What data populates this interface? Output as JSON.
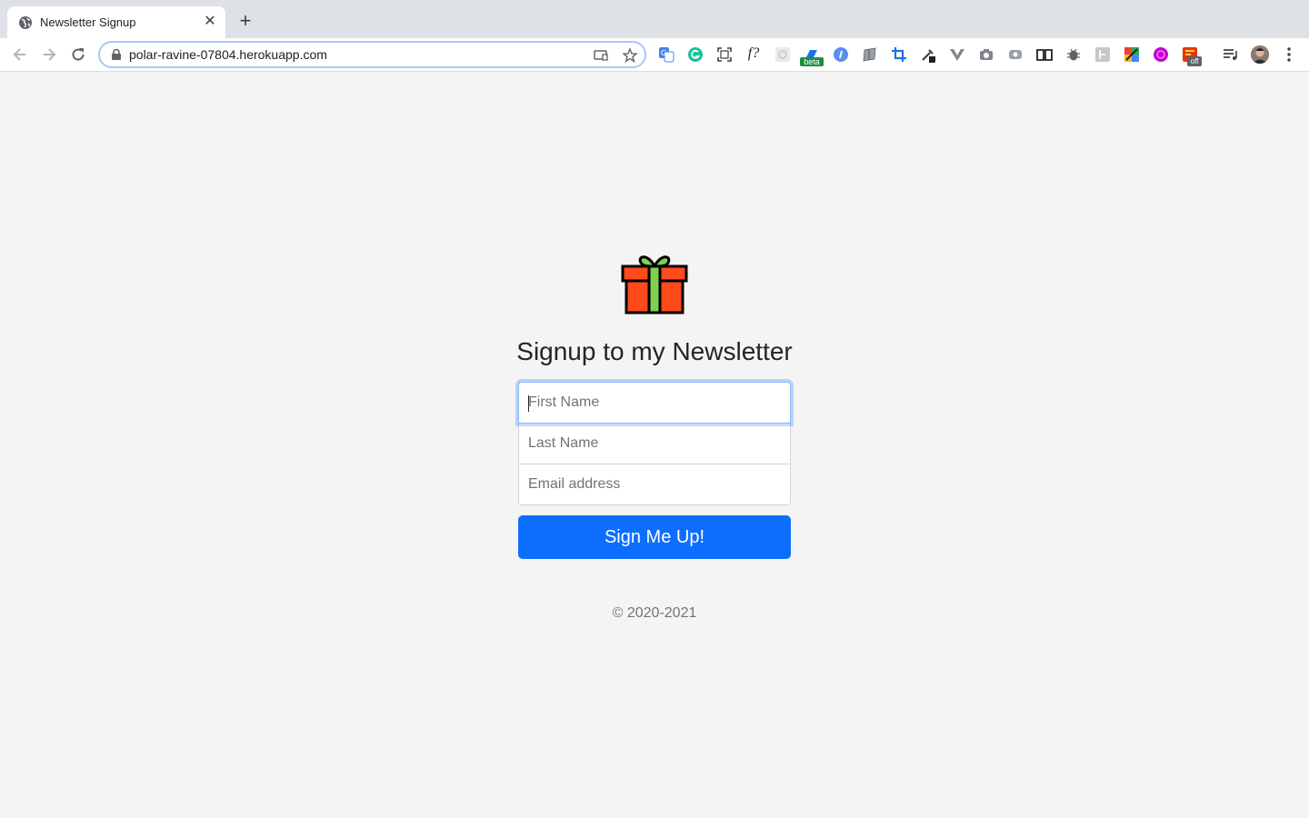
{
  "browser": {
    "tab": {
      "title": "Newsletter Signup",
      "close_glyph": "✕"
    },
    "new_tab_glyph": "+",
    "address": {
      "url": "polar-ravine-07804.herokuapp.com"
    },
    "extensions": [
      "translate-icon",
      "grammarly-icon",
      "screenshot-frame-icon",
      "font-finder-icon",
      "grid-extension-icon",
      "beta-extension-icon",
      "info-extension-icon",
      "book-extension-icon",
      "crop-extension-icon",
      "eyedropper-icon",
      "vue-devtools-icon",
      "camera-icon",
      "video-record-icon",
      "reader-icon",
      "bug-icon",
      "translate-alt-icon",
      "color-picker-icon",
      "purple-extension-icon",
      "pesticide-off-icon",
      "media-control-icon"
    ],
    "beta_badge": "beta",
    "off_badge": "off",
    "font_finder_label": "f?"
  },
  "signup": {
    "icon": "gift-icon",
    "heading": "Signup to my Newsletter",
    "first_name_placeholder": "First Name",
    "last_name_placeholder": "Last Name",
    "email_placeholder": "Email address",
    "submit_label": "Sign Me Up!",
    "footer": "© 2020-2021"
  },
  "colors": {
    "primary_button": "#0d6efd",
    "gift_box": "#ff4a1c",
    "gift_ribbon": "#7fd14f",
    "page_background": "#f4f4f4"
  }
}
